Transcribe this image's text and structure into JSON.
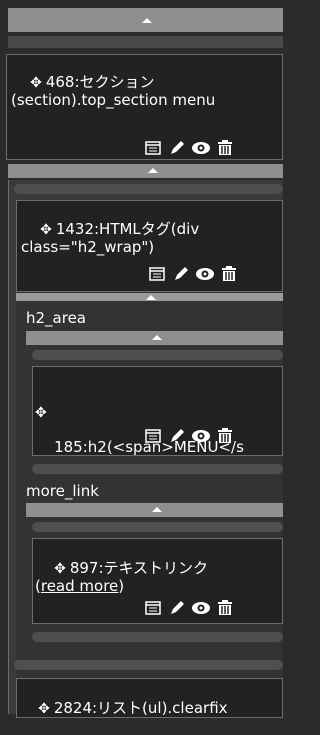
{
  "blocks": {
    "b1": {
      "id_label": "468:セクション(section).top_section menu"
    },
    "b2": {
      "id_label": "1432:HTMLタグ(div class=\"h2_wrap\")"
    },
    "b3": {
      "id_label": "185:h2(<span>MENU</s"
    },
    "b4": {
      "id_label_prefix": "897:テキストリンク",
      "id_label_link": "read more",
      "open": "(",
      "close": ")"
    },
    "b5": {
      "id_label": "2824:リスト(ul).clearfix"
    }
  },
  "areas": {
    "h2_area": "h2_area",
    "more_link": "more_link"
  },
  "icons": {
    "move": "move-arrows-icon",
    "layout": "layout-icon",
    "edit": "pencil-icon",
    "view": "eye-icon",
    "delete": "trash-icon"
  }
}
